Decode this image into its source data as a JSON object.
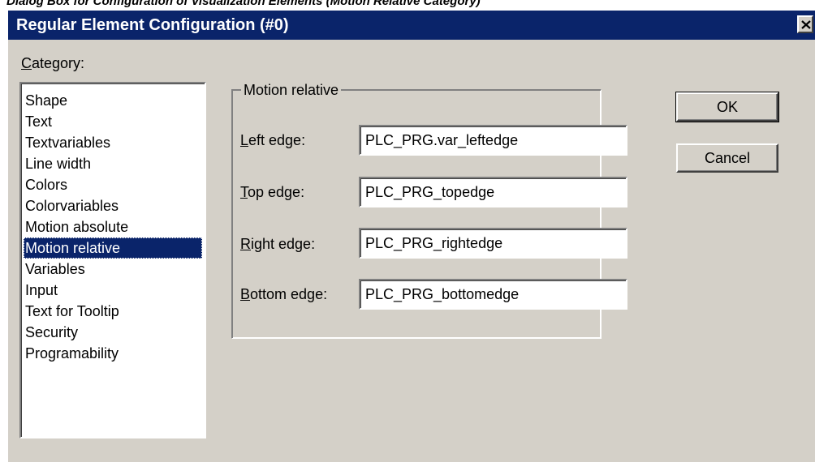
{
  "caption": "Dialog Box for Configuration of Visualization Elements (Motion Relative Category)",
  "window": {
    "title": "Regular Element Configuration (#0)",
    "close_icon": "close-icon"
  },
  "category": {
    "label_mnemonic": "C",
    "label_rest": "ategory:",
    "items": [
      "Shape",
      "Text",
      "Textvariables",
      "Line width",
      "Colors",
      "Colorvariables",
      "Motion absolute",
      "Motion relative",
      "Variables",
      "Input",
      "Text for Tooltip",
      "Security",
      "Programability"
    ],
    "selected": "Motion relative"
  },
  "group": {
    "title": "Motion relative",
    "fields": [
      {
        "mnemonic": "L",
        "rest": "eft edge:",
        "value": "PLC_PRG.var_leftedge"
      },
      {
        "mnemonic": "T",
        "rest": "op edge:",
        "value": "PLC_PRG_topedge"
      },
      {
        "mnemonic": "R",
        "rest": "ight edge:",
        "value": "PLC_PRG_rightedge"
      },
      {
        "mnemonic": "B",
        "rest": "ottom edge:",
        "value": "PLC_PRG_bottomedge"
      }
    ]
  },
  "buttons": {
    "ok": "OK",
    "cancel": "Cancel"
  },
  "colors": {
    "title_bar": "#0a246a",
    "dialog_face": "#d4d0c8",
    "selection": "#0a246a"
  }
}
